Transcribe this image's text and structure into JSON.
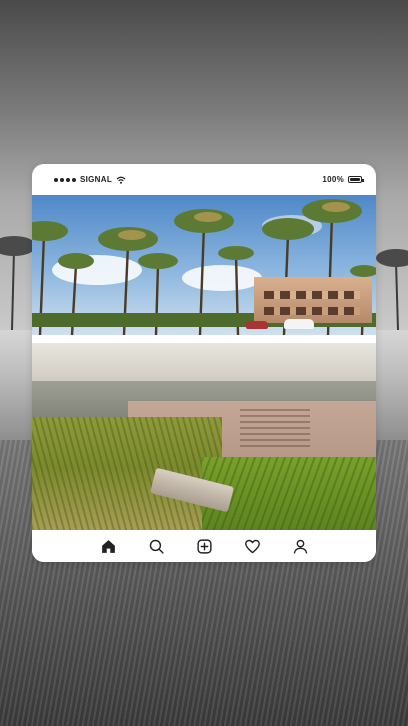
{
  "status_bar": {
    "carrier": "SIGNAL",
    "battery": "100%",
    "icons": [
      "signal-dots-icon",
      "wifi-icon",
      "battery-icon"
    ]
  },
  "photo": {
    "subject": "photo-post"
  },
  "tab_bar": {
    "items": [
      {
        "icon": "home-icon",
        "active": true
      },
      {
        "icon": "search-icon",
        "active": false
      },
      {
        "icon": "add-post-icon",
        "active": false
      },
      {
        "icon": "heart-icon",
        "active": false
      },
      {
        "icon": "profile-icon",
        "active": false
      }
    ]
  },
  "colors": {
    "card": "#ffffff",
    "icon": "#222222",
    "sky": "#4f88c8",
    "grass": "#7aa12a"
  }
}
